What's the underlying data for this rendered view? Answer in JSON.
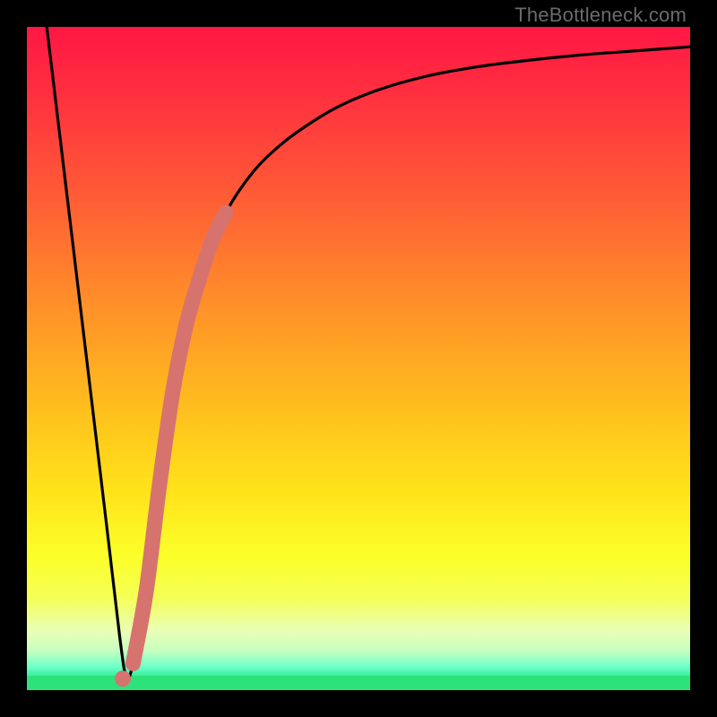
{
  "watermark": "TheBottleneck.com",
  "colors": {
    "frame": "#000000",
    "curve": "#000000",
    "highlight": "#d6736e",
    "bottom_band": "#2de27a",
    "gradient_stops": [
      {
        "offset": 0.0,
        "color": "#ff1744"
      },
      {
        "offset": 0.1,
        "color": "#ff2f3f"
      },
      {
        "offset": 0.25,
        "color": "#ff5a36"
      },
      {
        "offset": 0.4,
        "color": "#ff8a2a"
      },
      {
        "offset": 0.55,
        "color": "#ffb71f"
      },
      {
        "offset": 0.7,
        "color": "#ffe31a"
      },
      {
        "offset": 0.8,
        "color": "#fbff2a"
      },
      {
        "offset": 0.86,
        "color": "#f5ff55"
      },
      {
        "offset": 0.91,
        "color": "#eaffb5"
      },
      {
        "offset": 0.94,
        "color": "#c8ffc0"
      },
      {
        "offset": 0.965,
        "color": "#6dffc9"
      },
      {
        "offset": 0.985,
        "color": "#20e884"
      },
      {
        "offset": 1.0,
        "color": "#17df79"
      }
    ]
  },
  "chart_data": {
    "type": "line",
    "title": "",
    "xlabel": "",
    "ylabel": "",
    "xlim": [
      0,
      100
    ],
    "ylim": [
      0,
      100
    ],
    "x": [
      3,
      6,
      9,
      12,
      14,
      15,
      16,
      18,
      20,
      22,
      24,
      27,
      30,
      34,
      38,
      42,
      47,
      53,
      60,
      68,
      76,
      84,
      92,
      100
    ],
    "series": [
      {
        "name": "bottleneck-curve",
        "values": [
          100,
          75,
          50,
          25,
          8,
          2,
          4,
          15,
          31,
          45,
          55,
          65,
          72,
          78,
          82,
          85,
          88,
          90.5,
          92.5,
          94,
          95,
          95.8,
          96.4,
          97
        ]
      }
    ],
    "highlight_segment": {
      "note": "thick salmon overlay on rising limb",
      "x": [
        16.0,
        18.0,
        20.0,
        22.0,
        24.0,
        26.0,
        28.0,
        30.0
      ],
      "y": [
        4,
        15,
        31,
        45,
        55,
        62,
        68,
        72
      ]
    },
    "minimum_point": {
      "x": 15,
      "y": 2
    }
  }
}
